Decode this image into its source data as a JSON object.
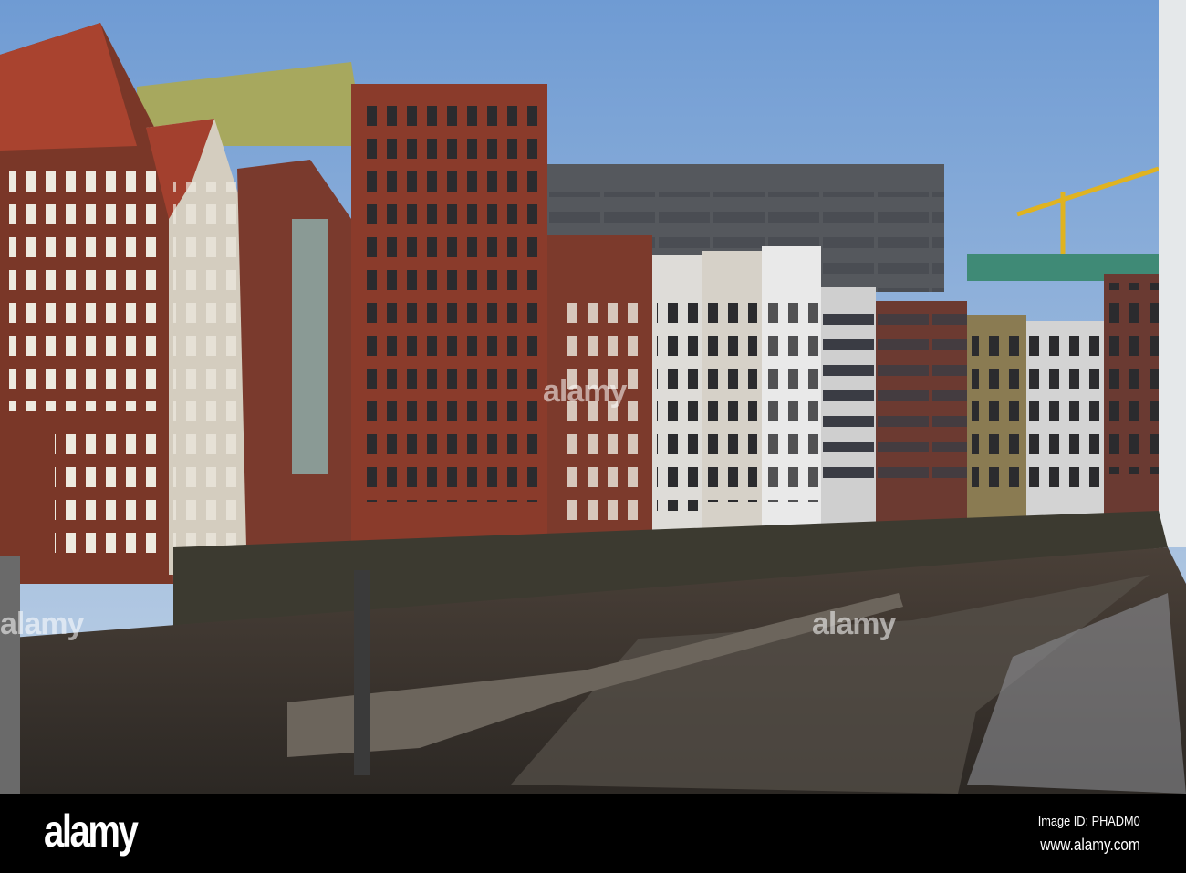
{
  "photo": {
    "subject": "Canal with historic brick and half-timbered buildings at low tide",
    "colors": {
      "sky_top": "#6f9bd3",
      "sky_bottom": "#c3d4e6",
      "water": "#3b3631",
      "brick": "#8a3b2b"
    }
  },
  "watermark": {
    "text": "alamy"
  },
  "footer": {
    "logo": "alamy",
    "image_id": "Image ID: PHADM0",
    "url": "www.alamy.com"
  }
}
